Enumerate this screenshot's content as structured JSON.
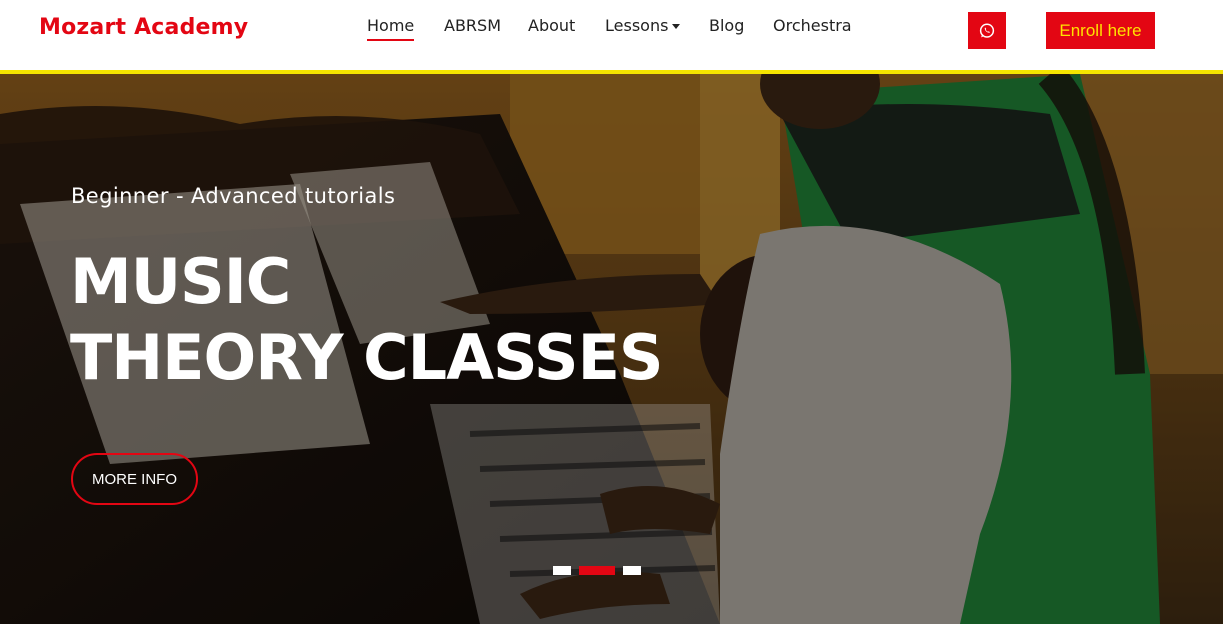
{
  "brand": "Mozart Academy",
  "nav": {
    "items": [
      {
        "label": "Home",
        "active": true
      },
      {
        "label": "ABRSM"
      },
      {
        "label": "About"
      },
      {
        "label": "Lessons",
        "dropdown": true
      },
      {
        "label": "Blog"
      },
      {
        "label": "Orchestra"
      }
    ]
  },
  "whatsapp": {
    "icon": "whatsapp-icon"
  },
  "enroll_label": "Enroll here",
  "hero": {
    "subtitle": "Beginner - Advanced tutorials",
    "title_line1": "MUSIC",
    "title_line2": "THEORY CLASSES",
    "button_label": "MORE INFO",
    "slides": 3,
    "active_slide": 2
  },
  "colors": {
    "accent": "#e30613",
    "highlight": "#f5e400",
    "enroll_text": "#ffe100"
  }
}
